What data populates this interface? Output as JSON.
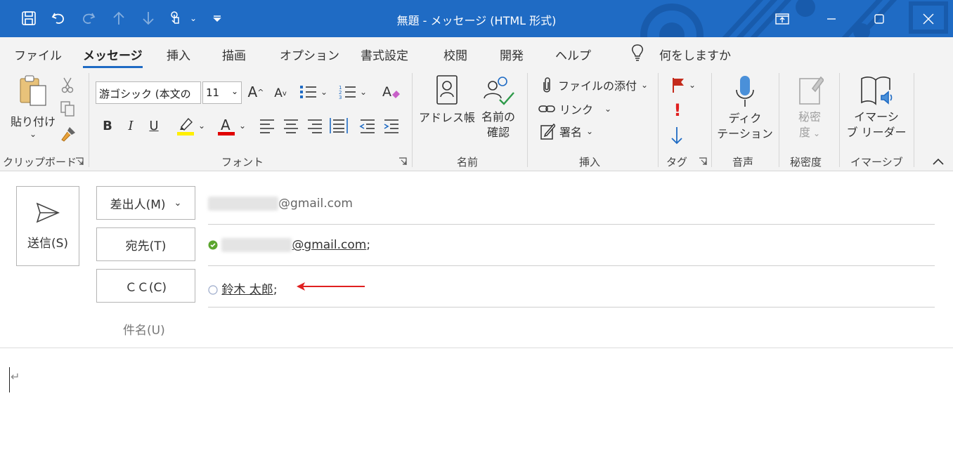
{
  "titlebar": {
    "title": "無題 - メッセージ (HTML 形式)",
    "accent": "#1f6bc4",
    "icons": [
      "save-icon",
      "undo-icon",
      "redo-icon",
      "up-arrow-icon",
      "down-arrow-icon",
      "touch-mode-icon",
      "customize-qat-icon"
    ],
    "window_buttons": [
      "restore-window-icon",
      "minimize-icon",
      "maximize-icon",
      "close-icon"
    ]
  },
  "tabs": [
    "ファイル",
    "メッセージ",
    "挿入",
    "描画",
    "オプション",
    "書式設定",
    "校閲",
    "開発",
    "ヘルプ"
  ],
  "active_tab": "メッセージ",
  "tell_me": "何をしますか",
  "ribbon": {
    "clipboard": {
      "paste": "貼り付け",
      "label": "クリップボード"
    },
    "font": {
      "name": "游ゴシック (本文の",
      "size": "11",
      "label": "フォント",
      "bold": "B",
      "italic": "I",
      "underline": "U",
      "font_color_glyph": "A"
    },
    "names": {
      "address_book": "アドレス帳",
      "check_names_1": "名前の",
      "check_names_2": "確認",
      "label": "名前"
    },
    "include": {
      "attach": "ファイルの添付",
      "link": "リンク",
      "signature": "署名",
      "label": "挿入"
    },
    "tags": {
      "label": "タグ"
    },
    "voice": {
      "dictate_1": "ディク",
      "dictate_2": "テーション",
      "label": "音声"
    },
    "sensitivity": {
      "btn_1": "秘密",
      "btn_2": "度",
      "label": "秘密度"
    },
    "immersive": {
      "btn_1": "イマーシ",
      "btn_2": "ブ リーダー",
      "label": "イマーシブ"
    }
  },
  "compose": {
    "send": "送信(S)",
    "from_btn": "差出人(M)",
    "from_value": "@gmail.com",
    "to_btn": "宛先(T)",
    "to_value": "@gmail.com",
    "to_sep": ";",
    "cc_btn": "ＣＣ(C)",
    "cc_value": "鈴木 太郎",
    "cc_sep": ";",
    "subject_label": "件名(U)"
  },
  "body": {
    "paragraph_mark": "↵"
  }
}
